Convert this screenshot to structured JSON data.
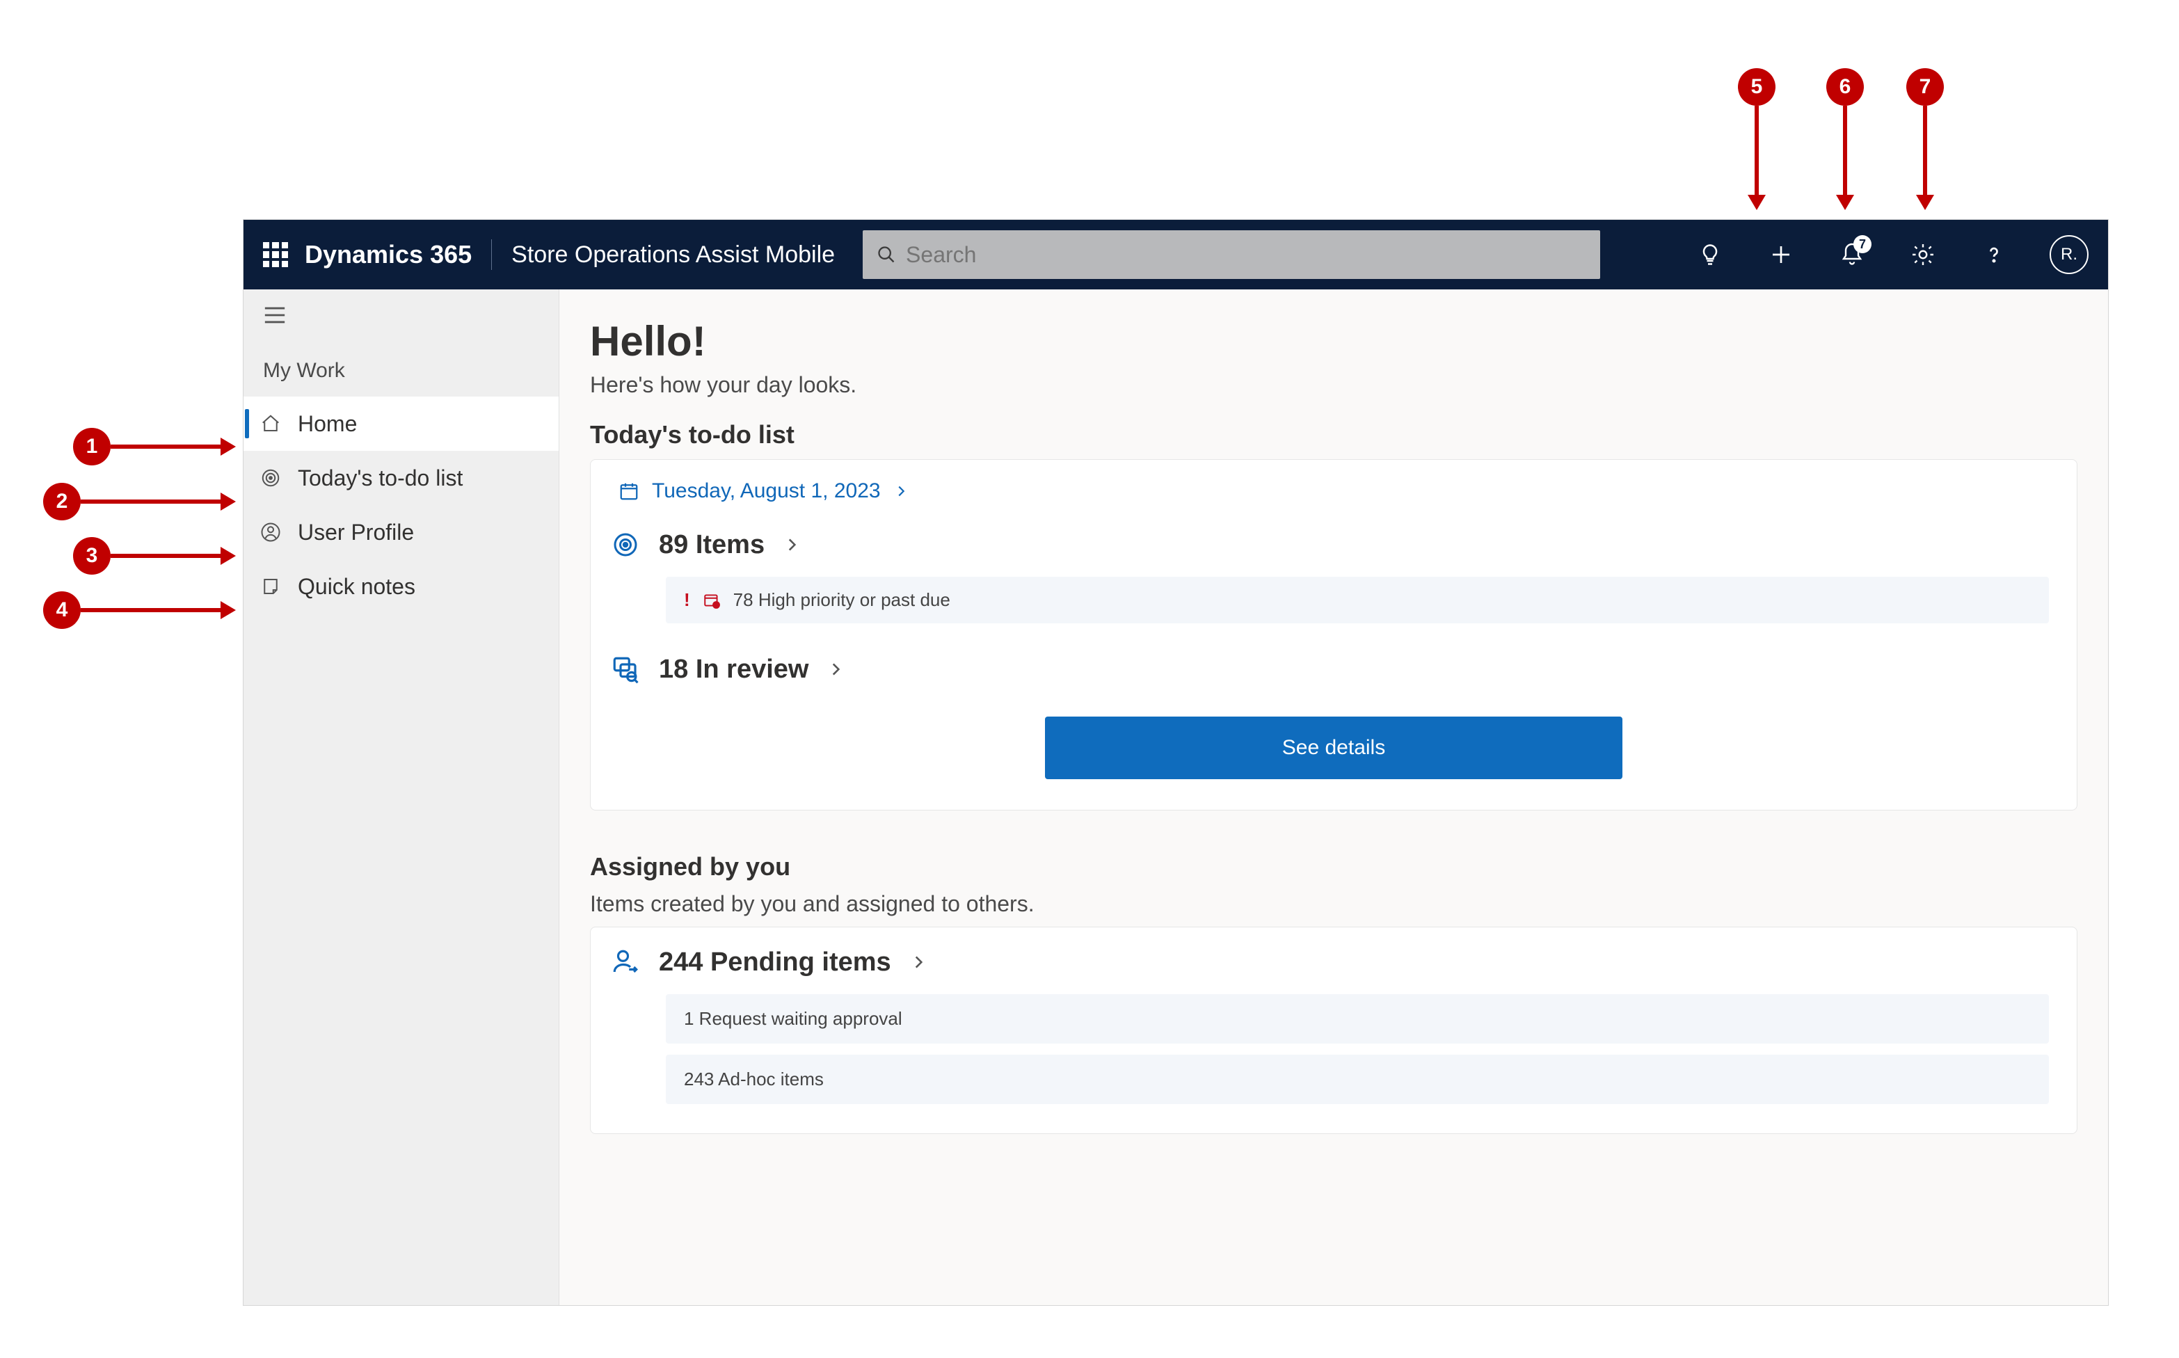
{
  "annotations": {
    "a1": "1",
    "a2": "2",
    "a3": "3",
    "a4": "4",
    "a5": "5",
    "a6": "6",
    "a7": "7"
  },
  "header": {
    "brand": "Dynamics 365",
    "app_name": "Store Operations Assist Mobile",
    "search_placeholder": "Search",
    "notification_count": "7",
    "avatar_initials": "R."
  },
  "sidebar": {
    "section_title": "My Work",
    "items": [
      {
        "label": "Home",
        "active": true
      },
      {
        "label": "Today's to-do list",
        "active": false
      },
      {
        "label": "User Profile",
        "active": false
      },
      {
        "label": "Quick notes",
        "active": false
      }
    ]
  },
  "main": {
    "greeting": "Hello!",
    "subgreeting": "Here's how your day looks.",
    "todo": {
      "title": "Today's to-do list",
      "date": "Tuesday, August 1, 2023",
      "items_count": "89 Items",
      "priority_alert": "78 High priority or past due",
      "in_review": "18 In review",
      "see_details": "See details"
    },
    "assigned": {
      "title": "Assigned by you",
      "subtitle": "Items created by you and assigned to others.",
      "pending": "244 Pending items",
      "req_approval": "1 Request waiting approval",
      "adhoc": "243 Ad-hoc items"
    }
  }
}
